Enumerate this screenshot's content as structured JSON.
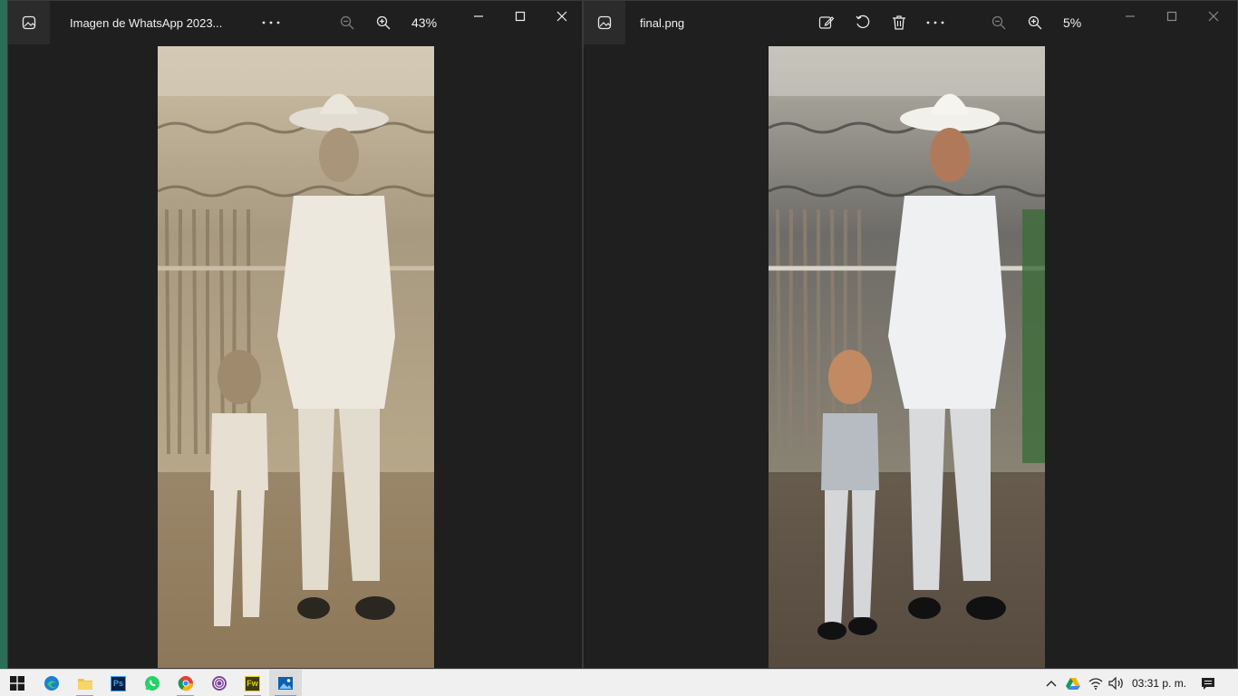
{
  "left_window": {
    "title": "Imagen de WhatsApp 2023...",
    "zoom": "43%",
    "icons": [
      "photos-app-icon",
      "more-icon",
      "zoom-out-icon",
      "zoom-in-icon",
      "minimize-icon",
      "maximize-icon",
      "close-icon"
    ]
  },
  "right_window": {
    "title": "final.png",
    "zoom": "5%",
    "icons": [
      "photos-app-icon",
      "edit-icon",
      "rotate-icon",
      "delete-icon",
      "more-icon",
      "zoom-out-icon",
      "zoom-in-icon",
      "minimize-icon",
      "maximize-icon",
      "close-icon"
    ]
  },
  "taskbar": {
    "apps": [
      "windows-start-icon",
      "edge-icon",
      "file-explorer-icon",
      "photoshop-icon",
      "whatsapp-icon",
      "chrome-icon",
      "tor-browser-icon",
      "fireworks-icon",
      "photos-icon"
    ],
    "photoshop_label": "Ps",
    "fireworks_label": "Fw",
    "clock": "03:31 p. m."
  }
}
